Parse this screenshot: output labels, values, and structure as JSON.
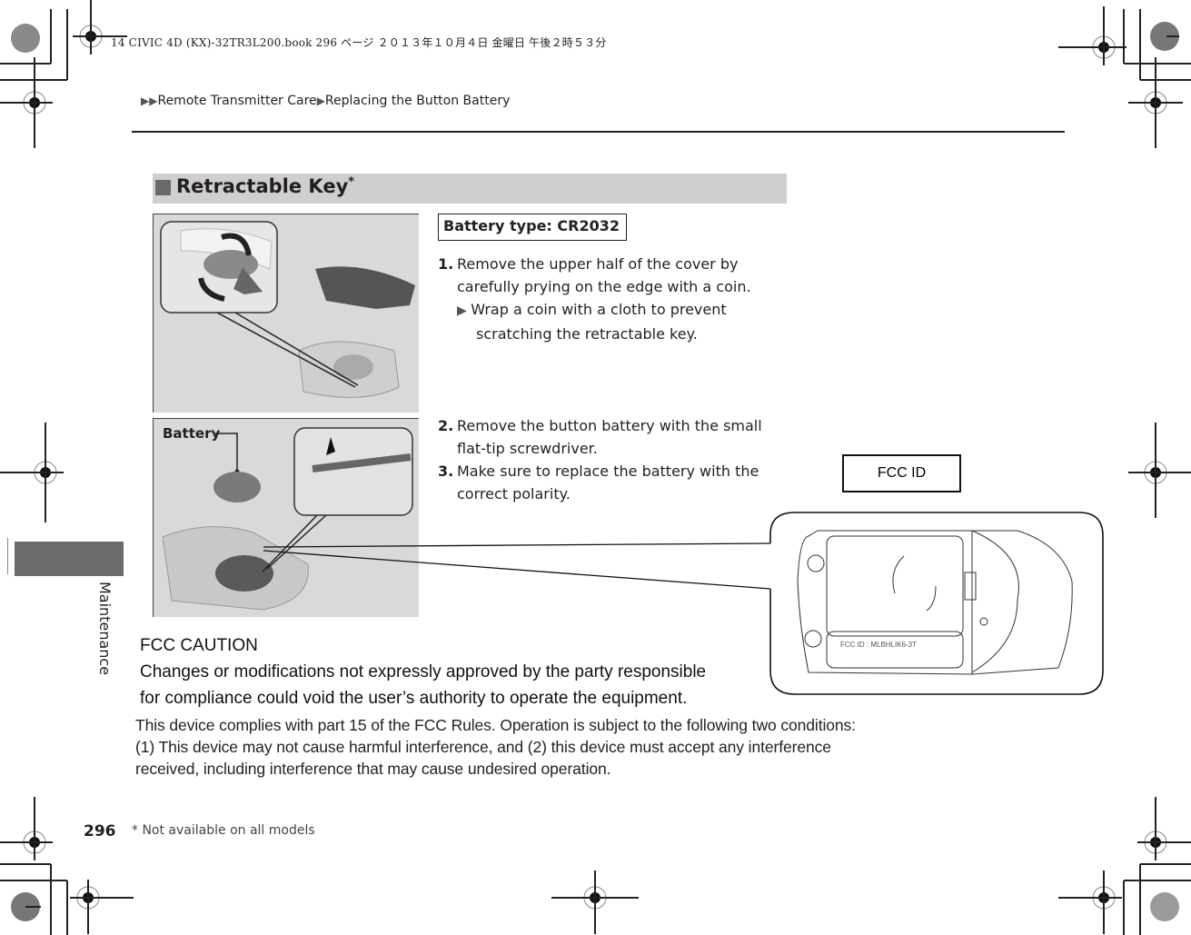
{
  "print_header": {
    "text": "14 CIVIC 4D (KX)-32TR3L200.book  296 ページ  ２０１３年１０月４日  金曜日  午後２時５３分"
  },
  "breadcrumb": {
    "items": [
      "Remote Transmitter Care",
      "Replacing the Button Battery"
    ],
    "arrow_icon": "▶"
  },
  "section": {
    "title": "Retractable Key",
    "marker": "*"
  },
  "battery_type": "Battery type: CR2032",
  "steps": [
    {
      "num": "1.",
      "lines": [
        "Remove the upper half of the cover by",
        "carefully prying on the edge with a coin."
      ],
      "note": [
        "Wrap a coin with a cloth to prevent",
        "scratching the retractable key."
      ]
    },
    {
      "num": "2.",
      "lines": [
        "Remove the button battery with the small",
        "flat-tip screwdriver."
      ]
    },
    {
      "num": "3.",
      "lines": [
        "Make sure to replace the battery with the",
        "correct polarity."
      ]
    }
  ],
  "figures": {
    "fig1_alt": "Prying cover open with coin",
    "fig2_label": "Battery"
  },
  "fcc_id_box": "FCC ID",
  "fcc_id_label": "FCC ID : MLBHLIK6-3T",
  "fcc_caution": {
    "title": "FCC CAUTION",
    "lines": [
      "Changes or modifications not expressly approved by the party responsible",
      "for compliance could void the user’s authority to operate the equipment."
    ]
  },
  "fcc_rules": {
    "lines": [
      "This device complies with part 15 of  the FCC Rules. Operation is subject to the following two conditions:",
      "(1)  This device may not  cause harmful interference, and (2) this device must accept any interference",
      "received, including interference that may cause undesired operation."
    ]
  },
  "side_tab": "Maintenance",
  "footer": {
    "page_number": "296",
    "footnote": "*  Not available on all models"
  }
}
